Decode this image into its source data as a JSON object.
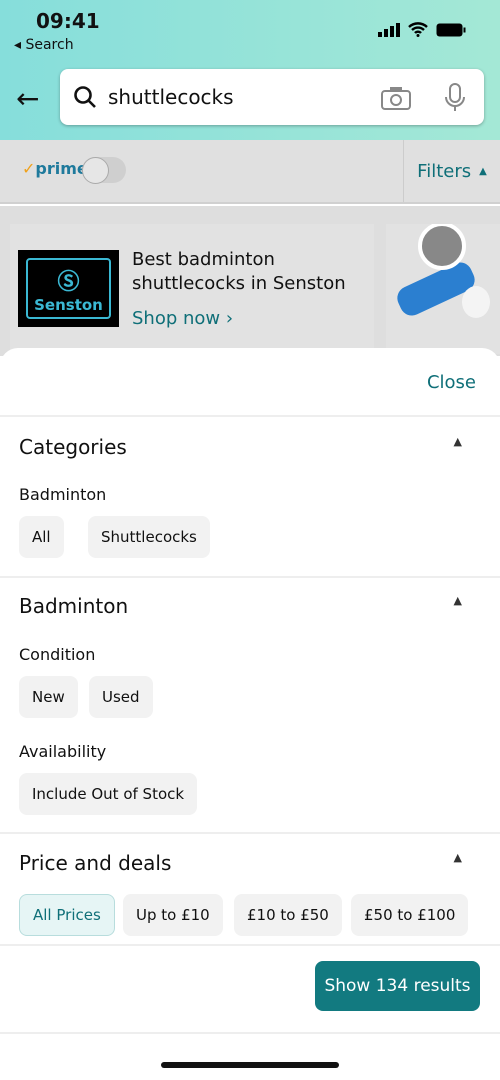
{
  "status": {
    "time": "09:41",
    "back_app": "◂ Search"
  },
  "search": {
    "query": "shuttlecocks"
  },
  "subbar": {
    "prime": "prime",
    "prime_check": "✓",
    "filters": "Filters",
    "prime_toggle_on": false
  },
  "promo": {
    "logo_text": "Senston",
    "title": "Best badminton shuttlecocks in Senston",
    "shop": "Shop now ›"
  },
  "sheet": {
    "close": "Close",
    "categories": {
      "title": "Categories",
      "group": "Badminton",
      "chips": [
        "All",
        "Shuttlecocks"
      ]
    },
    "badminton": {
      "title": "Badminton",
      "condition": "Condition",
      "condition_chips": [
        "New",
        "Used"
      ],
      "availability": "Availability",
      "availability_chips": [
        "Include Out of Stock"
      ]
    },
    "price": {
      "title": "Price and deals",
      "chips": [
        "All Prices",
        "Up to £10",
        "£10 to £50",
        "£50 to £100"
      ],
      "selected": "All Prices"
    },
    "show_button": "Show 134 results"
  },
  "colors": {
    "accent": "#127a80",
    "header_start": "#86dedb",
    "header_end": "#a4e8d6"
  }
}
